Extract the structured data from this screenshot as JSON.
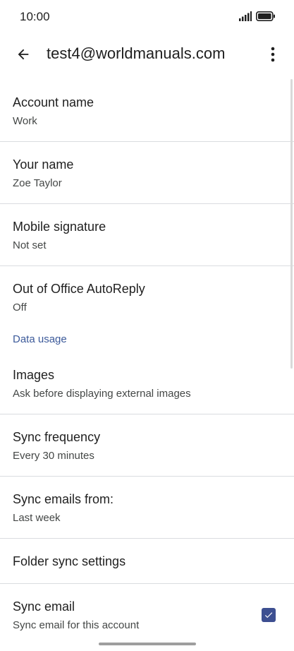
{
  "status_bar": {
    "time": "10:00",
    "signal_icon": "signal-icon",
    "battery_icon": "battery-icon"
  },
  "app_bar": {
    "back_icon": "back-arrow-icon",
    "title": "test4@worldmanuals.com",
    "more_icon": "more-vert-icon"
  },
  "items": {
    "account_name": {
      "title": "Account name",
      "summary": "Work"
    },
    "your_name": {
      "title": "Your name",
      "summary": "Zoe Taylor"
    },
    "mobile_signature": {
      "title": "Mobile signature",
      "summary": "Not set"
    },
    "out_of_office": {
      "title": "Out of Office AutoReply",
      "summary": "Off"
    }
  },
  "data_usage": {
    "header": "Data usage",
    "images": {
      "title": "Images",
      "summary": "Ask before displaying external images"
    },
    "sync_frequency": {
      "title": "Sync frequency",
      "summary": "Every 30 minutes"
    },
    "sync_emails_from": {
      "title": "Sync emails from:",
      "summary": "Last week"
    },
    "folder_sync": {
      "title": "Folder sync settings"
    },
    "sync_email": {
      "title": "Sync email",
      "summary": "Sync email for this account",
      "checked": true
    }
  },
  "colors": {
    "accent": "#3d4f91",
    "section_header": "#3c5a9a",
    "divider": "#dadce0"
  }
}
